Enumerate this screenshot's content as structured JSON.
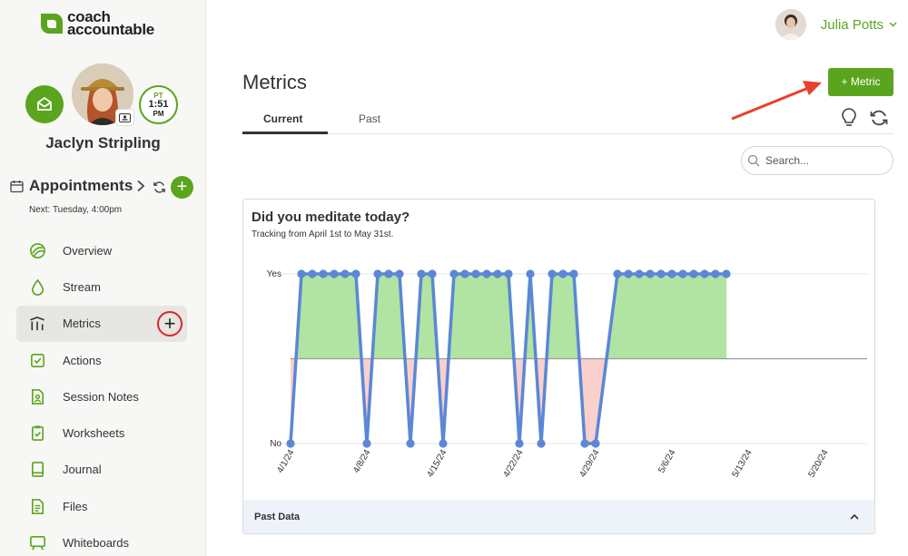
{
  "brand": {
    "name_line1": "coach",
    "name_line2": "accountable"
  },
  "client": {
    "name": "Jaclyn Stripling",
    "timezone": "PT",
    "time": "1:51",
    "ampm": "PM"
  },
  "appointments": {
    "label": "Appointments",
    "next": "Next: Tuesday, 4:00pm"
  },
  "nav": {
    "items": [
      {
        "label": "Overview",
        "icon": "overview-icon"
      },
      {
        "label": "Stream",
        "icon": "droplet-icon"
      },
      {
        "label": "Metrics",
        "icon": "metrics-icon",
        "active": true
      },
      {
        "label": "Actions",
        "icon": "checkbox-icon"
      },
      {
        "label": "Session Notes",
        "icon": "session-notes-icon"
      },
      {
        "label": "Worksheets",
        "icon": "clipboard-icon"
      },
      {
        "label": "Journal",
        "icon": "journal-icon"
      },
      {
        "label": "Files",
        "icon": "files-icon"
      },
      {
        "label": "Whiteboards",
        "icon": "whiteboard-icon"
      }
    ]
  },
  "user": {
    "name": "Julia Potts"
  },
  "page": {
    "title": "Metrics",
    "add_button": "+ Metric"
  },
  "tabs": {
    "current": "Current",
    "past": "Past"
  },
  "search": {
    "placeholder": "Search..."
  },
  "card": {
    "title": "Did you meditate today?",
    "subtitle": "Tracking from April 1st to May 31st.",
    "past_data": "Past Data"
  },
  "colors": {
    "accent": "#5aa51d",
    "line": "#5b87d6",
    "positive_fill": "#b1e3a2",
    "negative_fill": "#f9d0cc",
    "annotation": "#e8412a"
  },
  "chart_data": {
    "type": "line",
    "yticks": [
      "Yes",
      "No"
    ],
    "xticks": [
      "4/1/24",
      "4/8/24",
      "4/15/24",
      "4/22/24",
      "4/29/24",
      "5/6/24",
      "5/13/24",
      "5/20/24"
    ],
    "x_start": "4/1/24",
    "x_end": "5/26/24",
    "series": [
      {
        "values": [
          [
            "4/1/24",
            "No"
          ],
          [
            "4/2/24",
            "Yes"
          ],
          [
            "4/3/24",
            "Yes"
          ],
          [
            "4/4/24",
            "Yes"
          ],
          [
            "4/5/24",
            "Yes"
          ],
          [
            "4/6/24",
            "Yes"
          ],
          [
            "4/7/24",
            "Yes"
          ],
          [
            "4/8/24",
            "No"
          ],
          [
            "4/9/24",
            "Yes"
          ],
          [
            "4/10/24",
            "Yes"
          ],
          [
            "4/11/24",
            "Yes"
          ],
          [
            "4/12/24",
            "No"
          ],
          [
            "4/13/24",
            "Yes"
          ],
          [
            "4/14/24",
            "Yes"
          ],
          [
            "4/15/24",
            "No"
          ],
          [
            "4/16/24",
            "Yes"
          ],
          [
            "4/17/24",
            "Yes"
          ],
          [
            "4/18/24",
            "Yes"
          ],
          [
            "4/19/24",
            "Yes"
          ],
          [
            "4/20/24",
            "Yes"
          ],
          [
            "4/21/24",
            "Yes"
          ],
          [
            "4/22/24",
            "No"
          ],
          [
            "4/23/24",
            "Yes"
          ],
          [
            "4/24/24",
            "No"
          ],
          [
            "4/25/24",
            "Yes"
          ],
          [
            "4/26/24",
            "Yes"
          ],
          [
            "4/27/24",
            "Yes"
          ],
          [
            "4/28/24",
            "No"
          ],
          [
            "4/29/24",
            "No"
          ],
          [
            "5/1/24",
            "Yes"
          ],
          [
            "5/2/24",
            "Yes"
          ],
          [
            "5/3/24",
            "Yes"
          ],
          [
            "5/4/24",
            "Yes"
          ],
          [
            "5/5/24",
            "Yes"
          ],
          [
            "5/6/24",
            "Yes"
          ],
          [
            "5/7/24",
            "Yes"
          ],
          [
            "5/8/24",
            "Yes"
          ],
          [
            "5/9/24",
            "Yes"
          ],
          [
            "5/10/24",
            "Yes"
          ],
          [
            "5/11/24",
            "Yes"
          ]
        ]
      }
    ]
  }
}
